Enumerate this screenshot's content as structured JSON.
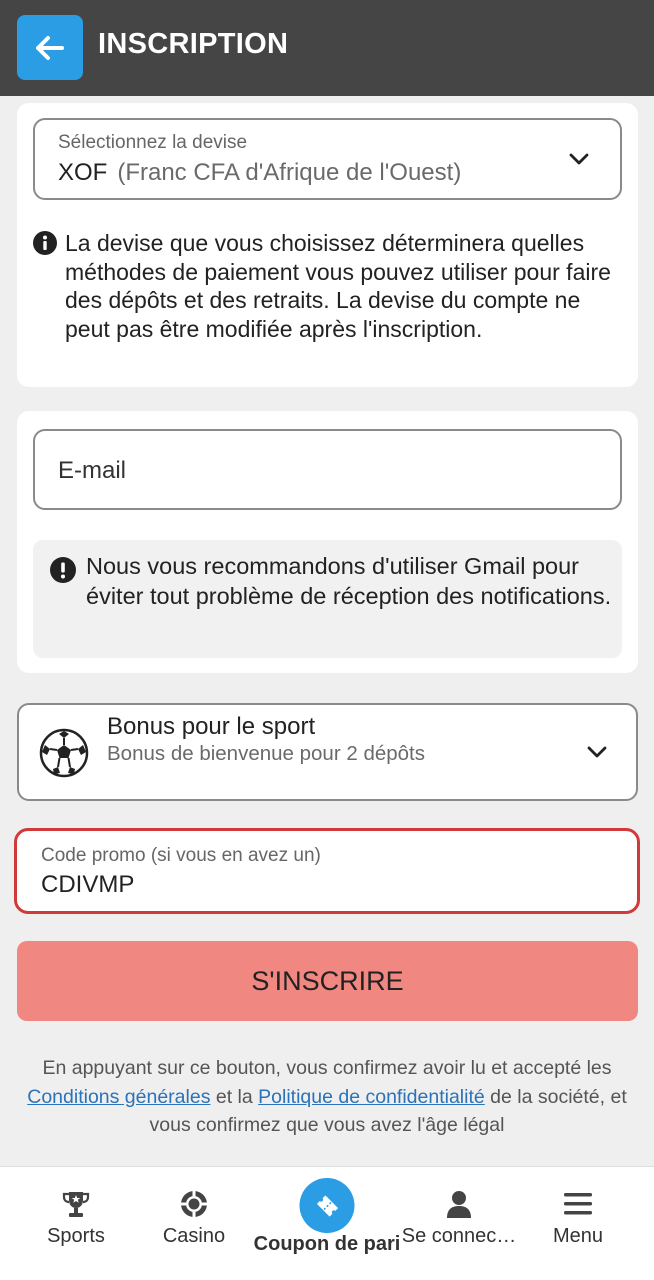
{
  "header": {
    "title": "INSCRIPTION"
  },
  "currency": {
    "label": "Sélectionnez la devise",
    "code": "XOF",
    "name": "(Franc CFA d'Afrique de l'Ouest)",
    "info": "La devise que vous choisissez déterminera quelles méthodes de paiement vous pouvez utiliser pour faire des dépôts et des retraits. La devise du compte ne peut pas être modifiée après l'inscription."
  },
  "email": {
    "placeholder": "E-mail",
    "note": "Nous vous recommandons d'utiliser Gmail pour éviter tout problème de réception des notifications."
  },
  "bonus": {
    "title": "Bonus pour le sport",
    "subtitle": "Bonus de bienvenue pour 2 dépôts"
  },
  "promo": {
    "label": "Code promo (si vous en avez un)",
    "value": "CDIVMP"
  },
  "submit_label": "S'INSCRIRE",
  "terms": {
    "part1": "En appuyant sur ce bouton, vous confirmez avoir lu et accepté les",
    "link1": "Conditions générales",
    "part2": "et la",
    "link2": "Politique de confidentialité",
    "part3": "de la société, et vous confirmez que vous avez l'âge légal"
  },
  "nav": {
    "sports": "Sports",
    "casino": "Casino",
    "coupon": "Coupon de pari",
    "login": "Se connec…",
    "menu": "Menu"
  },
  "colors": {
    "header_bg": "#454545",
    "accent": "#2a9de4",
    "submit_bg": "#f08780",
    "promo_border": "#d23a3a",
    "link": "#2a73b8"
  }
}
